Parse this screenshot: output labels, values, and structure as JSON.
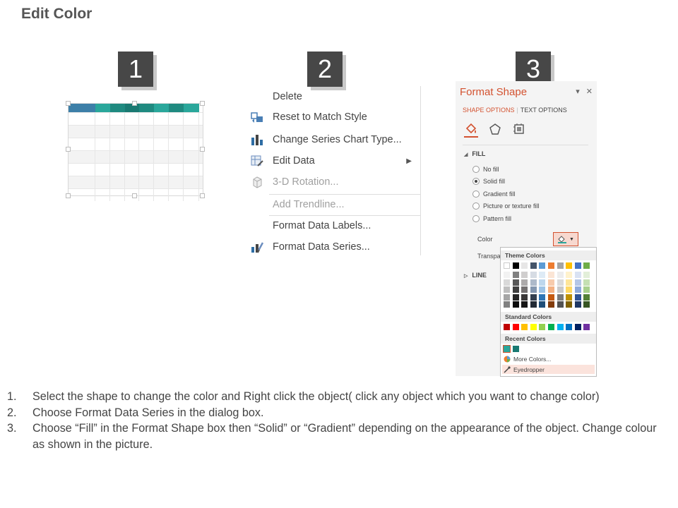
{
  "page": {
    "title": "Edit Color"
  },
  "badges": [
    "1",
    "2",
    "3"
  ],
  "table": {
    "header_colors": [
      "#3d7fa8",
      "#2aa79b",
      "#1f8a80",
      "#1a7a72",
      "#1f8a80",
      "#2aa79b",
      "#1f8a80",
      "#2aa79b"
    ]
  },
  "context_menu": {
    "items": [
      {
        "label": "Delete",
        "icon": "none",
        "enabled": true
      },
      {
        "label": "Reset to Match Style",
        "icon": "reset-style-icon",
        "enabled": true
      },
      {
        "label": "Change Series Chart Type...",
        "icon": "bar-chart-icon",
        "enabled": true
      },
      {
        "label": "Edit Data",
        "icon": "edit-data-icon",
        "enabled": true,
        "submenu": true
      },
      {
        "label": "3-D Rotation...",
        "icon": "cube-icon",
        "enabled": false
      },
      {
        "label": "Add Trendline...",
        "icon": "none",
        "enabled": false
      },
      {
        "label": "Format Data Labels...",
        "icon": "none",
        "enabled": true
      },
      {
        "label": "Format Data Series...",
        "icon": "format-series-icon",
        "enabled": true
      }
    ]
  },
  "format_shape": {
    "title": "Format Shape",
    "tab_active": "SHAPE OPTIONS",
    "tab_inactive": "TEXT OPTIONS",
    "fill_section": "FILL",
    "fill_options": [
      "No fill",
      "Solid fill",
      "Gradient fill",
      "Picture or texture fill",
      "Pattern fill"
    ],
    "fill_selected": "Solid fill",
    "color_label": "Color",
    "transparency_label": "Transpa",
    "line_section": "LINE",
    "accent": "#d35230"
  },
  "color_dropdown": {
    "theme_header": "Theme Colors",
    "theme_top": [
      "#ffffff",
      "#000000",
      "#e7e6e6",
      "#44546a",
      "#5b9bd5",
      "#ed7d31",
      "#a5a5a5",
      "#ffc000",
      "#4472c4",
      "#70ad47"
    ],
    "theme_columns": [
      [
        "#f2f2f2",
        "#d9d9d9",
        "#bfbfbf",
        "#a6a6a6",
        "#808080"
      ],
      [
        "#808080",
        "#595959",
        "#404040",
        "#262626",
        "#0d0d0d"
      ],
      [
        "#d0cece",
        "#aeabab",
        "#757171",
        "#3a3838",
        "#171616"
      ],
      [
        "#d6dce4",
        "#adb9ca",
        "#8497b0",
        "#333f4f",
        "#222a35"
      ],
      [
        "#deebf6",
        "#bdd7ee",
        "#9dc3e6",
        "#2e75b5",
        "#1e4e79"
      ],
      [
        "#fbe5d5",
        "#f7cbac",
        "#f4b183",
        "#c55a11",
        "#833c0b"
      ],
      [
        "#ededed",
        "#dbdbdb",
        "#c9c9c9",
        "#7b7b7b",
        "#525252"
      ],
      [
        "#fff2cc",
        "#fee599",
        "#ffd965",
        "#bf9000",
        "#7f6000"
      ],
      [
        "#d9e2f3",
        "#b4c6e7",
        "#8eaadb",
        "#2f5496",
        "#1f3864"
      ],
      [
        "#e2efd9",
        "#c5e0b3",
        "#a8d08d",
        "#538135",
        "#375623"
      ]
    ],
    "standard_header": "Standard Colors",
    "standard": [
      "#c00000",
      "#ff0000",
      "#ffc000",
      "#ffff00",
      "#92d050",
      "#00b050",
      "#00b0f0",
      "#0070c0",
      "#002060",
      "#7030a0"
    ],
    "recent_header": "Recent Colors",
    "recent": [
      "#2aa79b",
      "#1a7a72"
    ],
    "more_colors": "More Colors...",
    "eyedropper": "Eyedropper"
  },
  "instructions": [
    {
      "num": "1.",
      "text": "Select the shape to change the color and Right click the object( click any object which you want to change color)"
    },
    {
      "num": "2.",
      "text": "Choose Format Data Series in the dialog box."
    },
    {
      "num": "3.",
      "text": "Choose “Fill” in the Format Shape box then “Solid” or “Gradient” depending on the appearance of the object. Change colour as shown in the picture."
    }
  ]
}
